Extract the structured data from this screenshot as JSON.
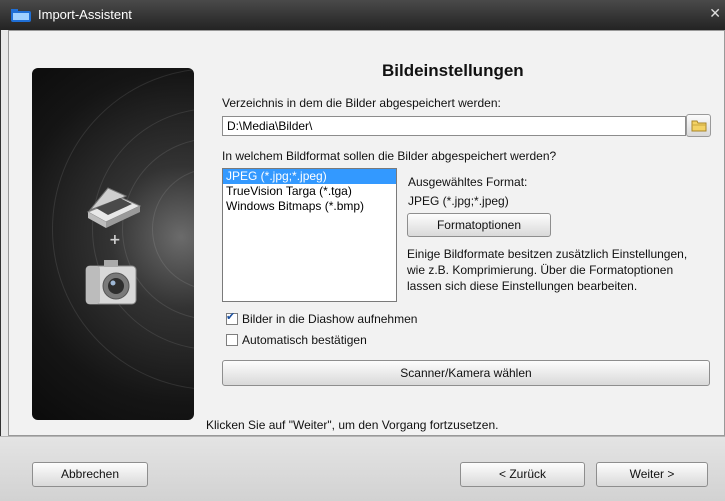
{
  "window": {
    "title": "Import-Assistent"
  },
  "page": {
    "heading": "Bildeinstellungen"
  },
  "directory": {
    "label": "Verzeichnis in dem die Bilder abgespeichert werden:",
    "value": "D:\\Media\\Bilder\\"
  },
  "format": {
    "label": "In welchem Bildformat sollen die Bilder abgespeichert werden?",
    "options": [
      "JPEG (*.jpg;*.jpeg)",
      "TrueVision Targa (*.tga)",
      "Windows Bitmaps (*.bmp)"
    ],
    "selected_index": 0,
    "selected_label": "Ausgewähltes Format:",
    "selected_value": "JPEG (*.jpg;*.jpeg)",
    "options_button": "Formatoptionen",
    "description": "Einige Bildformate besitzen zusätzlich Einstellungen, wie z.B. Komprimierung. Über die Formatoptionen lassen sich diese Einstellungen bearbeiten."
  },
  "checkboxes": [
    {
      "label": "Bilder in die Diashow aufnehmen",
      "checked": true
    },
    {
      "label": "Automatisch bestätigen",
      "checked": false
    }
  ],
  "scanner_button": "Scanner/Kamera wählen",
  "hint": "Klicken Sie auf \"Weiter\", um den Vorgang fortzusetzen.",
  "buttons": {
    "cancel": "Abbrechen",
    "back": "< Zurück",
    "next": "Weiter >"
  },
  "icons": {
    "app": "import-icon",
    "folder": "folder-icon",
    "scanner": "scanner-icon",
    "camera": "camera-icon",
    "close": "close-icon"
  },
  "colors": {
    "selection": "#3399ff",
    "titlebar": "#2b2b2b"
  }
}
